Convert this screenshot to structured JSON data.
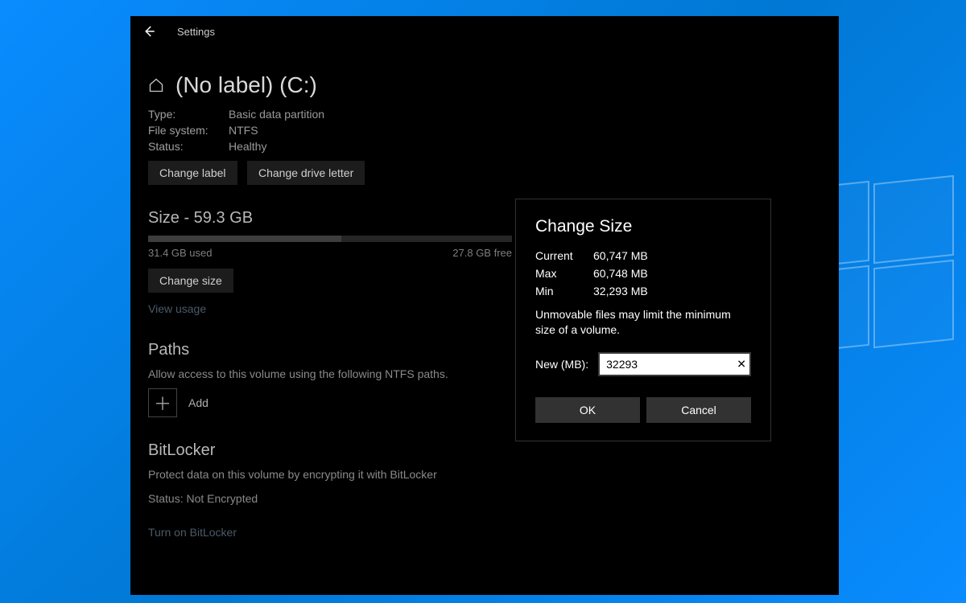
{
  "header": {
    "settings_label": "Settings"
  },
  "page": {
    "title": "(No label) (C:)",
    "info": {
      "type_label": "Type:",
      "type_value": "Basic data partition",
      "fs_label": "File system:",
      "fs_value": "NTFS",
      "status_label": "Status:",
      "status_value": "Healthy"
    },
    "buttons": {
      "change_label": "Change label",
      "change_drive_letter": "Change drive letter",
      "change_size": "Change size"
    },
    "size": {
      "heading": "Size - 59.3 GB",
      "used": "31.4 GB used",
      "free": "27.8 GB free",
      "used_percent": 53
    },
    "view_usage": "View usage",
    "paths": {
      "heading": "Paths",
      "desc": "Allow access to this volume using the following NTFS paths.",
      "add_label": "Add"
    },
    "bitlocker": {
      "heading": "BitLocker",
      "desc": "Protect data on this volume by encrypting it with BitLocker",
      "status": "Status: Not Encrypted",
      "turn_on": "Turn on BitLocker"
    }
  },
  "dialog": {
    "title": "Change Size",
    "current_label": "Current",
    "current_value": "60,747 MB",
    "max_label": "Max",
    "max_value": "60,748 MB",
    "min_label": "Min",
    "min_value": "32,293 MB",
    "note": "Unmovable files may limit the minimum size of a volume.",
    "new_label": "New (MB):",
    "new_value": "32293",
    "ok": "OK",
    "cancel": "Cancel"
  }
}
